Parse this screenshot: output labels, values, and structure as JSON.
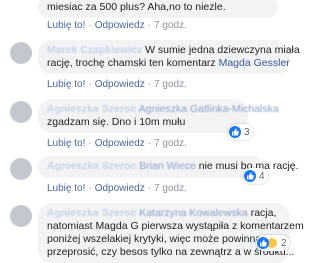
{
  "comments": [
    {
      "author": "",
      "text_lines": [
        "miesiac za 500 plus? Aha,no to niezle."
      ],
      "actions": {
        "like": "Lubię to!",
        "reply": "Odpowiedz",
        "time": "7 godz."
      }
    },
    {
      "author": "Marek Czapkiewicz",
      "text_line1": "W sumie jedna dziewczyna miała",
      "text_line2": "rację, trochę chamski ten komentarz",
      "mention": "Magda Gessler",
      "actions": {
        "like": "Lubię to!",
        "reply": "Odpowiedz",
        "time": "7 godz."
      }
    },
    {
      "author": "Agnieszka Szeroc",
      "mention": "Agnieszka Gatlinka-Michalska",
      "text": "zgadzam się. Dno i 10m mułu",
      "reaction_count": "3",
      "actions": {
        "like": "Lubię to!",
        "reply": "Odpowiedz",
        "time": "7 godz."
      }
    },
    {
      "author": "Agnieszka Szeroc",
      "mention": "Brian Wiece",
      "text": "nie musi bo ma rację.",
      "reaction_count": "4",
      "actions": {
        "like": "Lubię to!",
        "reply": "Odpowiedz",
        "time": "7 godz."
      }
    },
    {
      "author": "Agnieszka Szeroc",
      "mention": "Katarzyna Kowalewska",
      "text_line1": "racja,",
      "text_line2": "natomiast Magda G pierwsza wystąpiła z komentarzem",
      "text_line3": "poniżej wszelakiej krytyki, więc może powinna",
      "text_line4": "przeprosić, czy besos tylko na zewnątrz a w środku...",
      "reaction_count": "2"
    }
  ]
}
